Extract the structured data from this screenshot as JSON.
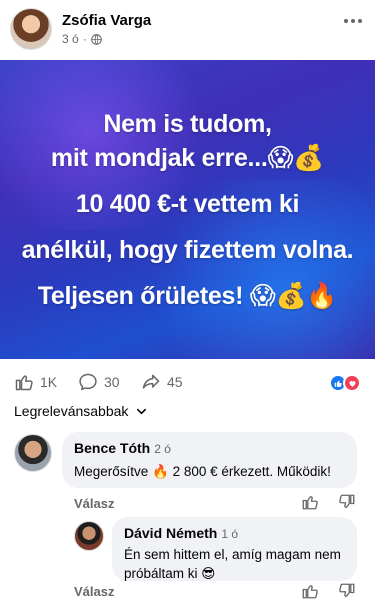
{
  "post": {
    "author": "Zsófia Varga",
    "time": "3 ó",
    "banner_lines": [
      "Nem is tudom,",
      "mit mondjak erre...😱💰",
      "10 400 €-t vettem ki",
      "anélkül, hogy fizettem volna.",
      "Teljesen őrületes! 😱💰🔥"
    ]
  },
  "reactions": {
    "likes": "1K",
    "comments": "30",
    "shares": "45"
  },
  "sort_label": "Legrelevánsabbak",
  "comments": [
    {
      "name": "Bence Tóth",
      "time": "2 ó",
      "text": "Megerősítve 🔥 2 800 € érkezett. Működik!",
      "reply_label": "Válasz"
    },
    {
      "name": "Dávid Németh",
      "time": "1 ó",
      "text": "Én sem hittem el, amíg magam nem próbáltam ki 😎",
      "reply_label": "Válasz"
    }
  ],
  "colors": {
    "accent": "#1877f2",
    "love": "#f33e58",
    "muted": "#65676b",
    "bubble_bg": "#f0f2f5"
  }
}
